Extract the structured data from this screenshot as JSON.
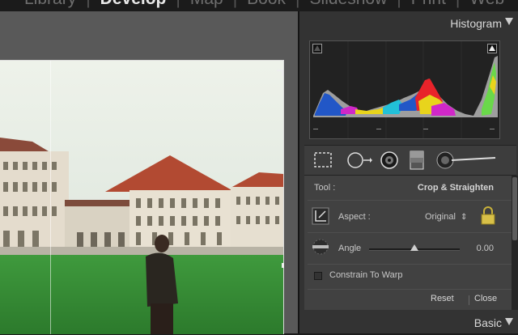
{
  "modules": [
    "Library",
    "Develop",
    "Map",
    "Book",
    "Slideshow",
    "Print",
    "Web"
  ],
  "active_module": "Develop",
  "panels": {
    "histogram": {
      "title": "Histogram",
      "shadow_clipping_on": false,
      "highlight_clipping_on": true
    },
    "basic": {
      "title": "Basic"
    }
  },
  "crop": {
    "tool_label": "Tool :",
    "tool_name": "Crop & Straighten",
    "aspect_label": "Aspect :",
    "aspect_value": "Original",
    "aspect_arrows": "⇕",
    "angle_label": "Angle",
    "angle_value": "0.00",
    "angle_position": 0.5,
    "constrain_label": "Constrain To Warp",
    "constrain_checked": false,
    "reset_label": "Reset",
    "close_label": "Close"
  },
  "tool_icons": [
    "crop-overlay-icon",
    "spot-removal-icon",
    "red-eye-icon",
    "graduated-filter-icon",
    "adjustment-brush-icon"
  ],
  "colors": {
    "accent": "#e8e8e8",
    "panel": "#333333",
    "red": "#e8232a",
    "yellow": "#e8d41c",
    "blue": "#2257c7"
  }
}
